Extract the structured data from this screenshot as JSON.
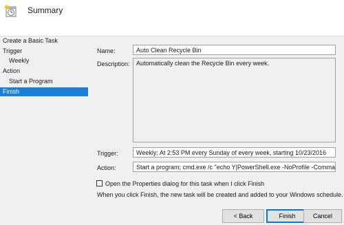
{
  "header": {
    "title": "Summary",
    "icon": "task-clock-icon"
  },
  "sidebar": {
    "items": [
      {
        "label": "Create a Basic Task"
      },
      {
        "label": "Trigger"
      },
      {
        "label": "Weekly"
      },
      {
        "label": "Action"
      },
      {
        "label": "Start a Program"
      },
      {
        "label": "Finish",
        "selected": true
      }
    ]
  },
  "form": {
    "name_label": "Name:",
    "name_value": "Auto Clean Recycle Bin",
    "description_label": "Description:",
    "description_value": "Automatically clean the Recycle Bin every week.",
    "trigger_label": "Trigger:",
    "trigger_value": "Weekly; At 2:53 PM every Sunday of every week, starting 10/23/2016",
    "action_label": "Action:",
    "action_value": "Start a program; cmd.exe /c \"echo Y|PowerShell.exe -NoProfile -Command C"
  },
  "options": {
    "open_properties_label": "Open the Properties dialog for this task when I click Finish",
    "open_properties_checked": false,
    "info_text": "When you click Finish, the new task will be created and added to your Windows schedule."
  },
  "buttons": {
    "back": "< Back",
    "finish": "Finish",
    "cancel": "Cancel"
  },
  "colors": {
    "selection": "#1a7fd8",
    "panel": "#f0f0f0",
    "default_button_border": "#0078d7"
  }
}
